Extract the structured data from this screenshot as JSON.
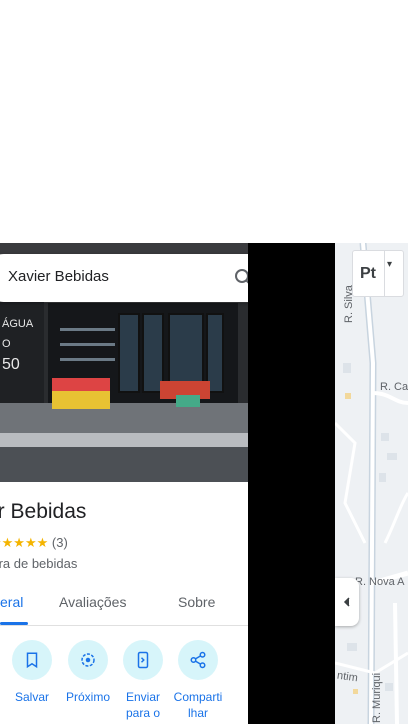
{
  "search": {
    "query": "Xavier Bebidas"
  },
  "photo": {
    "sign_lines": [
      "ÁGUA",
      "O",
      "50"
    ]
  },
  "place": {
    "title": "er Bebidas",
    "rating_count": "(3)",
    "stars": "★★★★★",
    "category": "uidora de bebidas"
  },
  "tabs": [
    {
      "label": "eral",
      "active": true
    },
    {
      "label": "Avaliações",
      "active": false
    },
    {
      "label": "Sobre",
      "active": false
    }
  ],
  "actions": [
    {
      "label": "Salvar",
      "icon": "bookmark-icon"
    },
    {
      "label": "Próximo",
      "icon": "nearby-icon"
    },
    {
      "label": "Enviar para o",
      "icon": "send-to-phone-icon"
    },
    {
      "label": "Compartilhar",
      "label_lines": [
        "Comparti",
        "lhar"
      ],
      "icon": "share-icon"
    }
  ],
  "map": {
    "layer_button_label": "Pt",
    "street_labels": [
      "R. Silva",
      "R. Ca",
      "R. Nova A",
      "ntim",
      "R. Muriqui"
    ]
  },
  "colors": {
    "accent": "#1a73e8",
    "action_bg": "#d7f5fa",
    "star": "#f4b400"
  }
}
